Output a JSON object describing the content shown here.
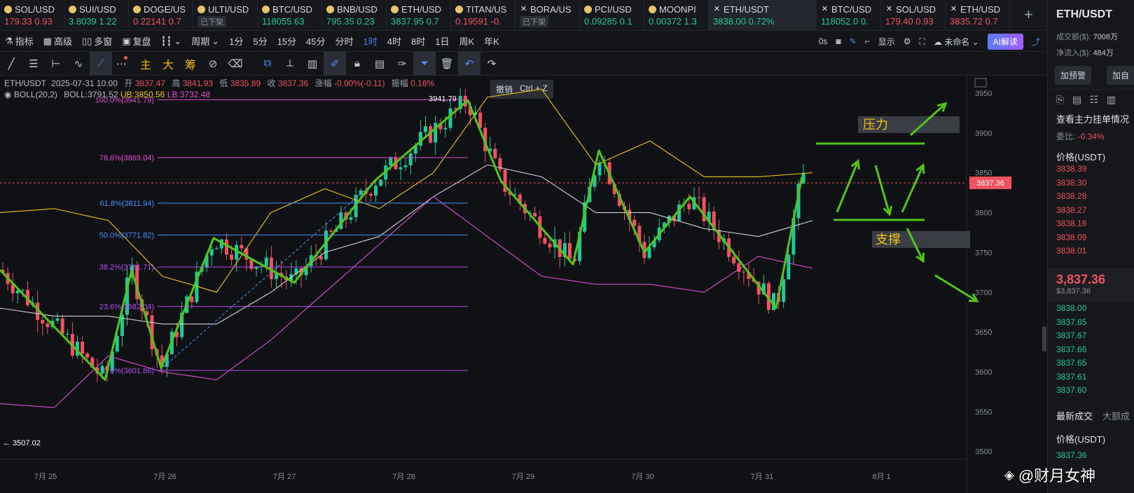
{
  "tabs": [
    {
      "symbol": "SOL/USD",
      "price": "179.33",
      "change": "0.93",
      "dir": "dn",
      "icon": "coin"
    },
    {
      "symbol": "SUI/USD",
      "price": "3.8039",
      "change": "1.22",
      "dir": "up",
      "icon": "coin"
    },
    {
      "symbol": "DOGE/US",
      "price": "0.22141",
      "change": "0.7",
      "dir": "dn",
      "icon": "coin"
    },
    {
      "symbol": "ULTI/USD",
      "price": "",
      "change": "",
      "dir": "dn",
      "icon": "coin",
      "badge": "已下架"
    },
    {
      "symbol": "BTC/USD",
      "price": "118055.63",
      "change": "",
      "dir": "up",
      "icon": "coin"
    },
    {
      "symbol": "BNB/USD",
      "price": "795.35",
      "change": "0.23",
      "dir": "up",
      "icon": "coin"
    },
    {
      "symbol": "ETH/USD",
      "price": "3837.95",
      "change": "0.7",
      "dir": "up",
      "icon": "coin"
    },
    {
      "symbol": "TITAN/US",
      "price": "0.19591",
      "change": "-0.",
      "dir": "dn",
      "icon": "coin"
    },
    {
      "symbol": "BORA/US",
      "price": "",
      "change": "",
      "dir": "dn",
      "icon": "x",
      "badge": "已下架"
    },
    {
      "symbol": "PCI/USD",
      "price": "0.09285",
      "change": "0.1",
      "dir": "up",
      "icon": "coin"
    },
    {
      "symbol": "MOONPI",
      "price": "0.00372",
      "change": "1.3",
      "dir": "up",
      "icon": "coin"
    }
  ],
  "active_tab": {
    "symbol": "ETH/USDT",
    "price": "3838.00",
    "change": "0.72%"
  },
  "right_tabs": [
    {
      "symbol": "BTC/USD",
      "price": "118052.0",
      "change": "0.",
      "dir": "up"
    },
    {
      "symbol": "SOL/USD",
      "price": "179.40",
      "change": "0.93",
      "dir": "dn"
    },
    {
      "symbol": "ETH/USD",
      "price": "3835.72",
      "change": "0.7",
      "dir": "dn"
    }
  ],
  "toolbar": {
    "indicators": "指标",
    "advanced": "高级",
    "multi_window": "多窗",
    "replay": "复盘",
    "period": "周期",
    "intervals": [
      "1分",
      "5分",
      "15分",
      "45分",
      "分时",
      "1时",
      "4时",
      "8时",
      "1日",
      "周K",
      "年K"
    ],
    "active_interval": "1时",
    "delay": "0s",
    "display": "显示",
    "unnamed": "未命名",
    "ai": "AI解读"
  },
  "drawing_tools": {
    "main": "主",
    "big": "大",
    "chip": "筹"
  },
  "info": {
    "symbol": "ETH/USDT",
    "datetime": "2025-07-31 10:00",
    "open_label": "开",
    "open": "3837.47",
    "high_label": "高",
    "high": "3841.93",
    "low_label": "低",
    "low": "3835.89",
    "close_label": "收",
    "close": "3837.36",
    "change_label": "涨幅",
    "change": "-0.00%(-0.11)",
    "amp_label": "振幅",
    "amp": "0.16%"
  },
  "boll": {
    "name": "BOLL(20,2)",
    "boll": "BOLL:3791.52",
    "ub": "UB:3850.56",
    "lb": "LB:3732.48"
  },
  "tooltip": {
    "label": "撤销",
    "shortcut": "Ctrl + Z"
  },
  "chart_data": {
    "type": "candlestick",
    "x_ticks": [
      "7月 25",
      "7月 26",
      "7月 27",
      "7月 28",
      "7月 29",
      "7月 30",
      "7月 31",
      "8月 1"
    ],
    "y_ticks": [
      3950,
      3900,
      3850,
      3800,
      3750,
      3700,
      3650,
      3600,
      3550,
      3500
    ],
    "ylim": [
      3490,
      3965
    ],
    "fib_levels": [
      {
        "label": "100.0%(3941.79)",
        "value": 3941.79,
        "color": "#e34bd6"
      },
      {
        "label": "78.6%(3869.04)",
        "value": 3869.04,
        "color": "#e34bd6"
      },
      {
        "label": "61.8%(3811.94)",
        "value": 3811.94,
        "color": "#4d8cff"
      },
      {
        "label": "50.0%(3771.82)",
        "value": 3771.82,
        "color": "#4d8cff"
      },
      {
        "label": "38.2%(3731.71)",
        "value": 3731.71,
        "color": "#b14cf2"
      },
      {
        "label": "23.6%(3682.04)",
        "value": 3682.04,
        "color": "#b14cf2"
      },
      {
        "label": "0.0%(3601.86)",
        "value": 3601.86,
        "color": "#b14cf2"
      }
    ],
    "high_marker": "3941.79",
    "low_marker": "3507.02",
    "last_price": "3837.36",
    "annotation_pressure": "压力",
    "annotation_support": "支撑",
    "zigzag_prices": [
      3728,
      3590,
      3728,
      3605,
      3768,
      3712,
      3840,
      3941,
      3840,
      3735,
      3878,
      3750,
      3820,
      3680,
      3845
    ],
    "upper_band": [
      3800,
      3805,
      3790,
      3720,
      3700,
      3800,
      3830,
      3805,
      3850,
      3945,
      3955,
      3860,
      3890,
      3845,
      3845,
      3850
    ],
    "lower_band": [
      3560,
      3555,
      3620,
      3600,
      3590,
      3640,
      3700,
      3760,
      3820,
      3770,
      3720,
      3710,
      3710,
      3700,
      3745,
      3730
    ],
    "middle_band": [
      3680,
      3670,
      3670,
      3660,
      3660,
      3700,
      3750,
      3770,
      3820,
      3860,
      3845,
      3800,
      3800,
      3780,
      3770,
      3790
    ]
  },
  "right_panel": {
    "title": "ETH/USDT",
    "turnover_label": "成交额($):",
    "turnover": "7008万",
    "inflow_label": "净流入($):",
    "inflow": "484万",
    "alert_btn": "加预警",
    "add_btn": "加自",
    "main_orders": "查看主力挂单情况",
    "ratio_label": "委比:",
    "ratio": "-0.34%",
    "price_header": "价格(USDT)",
    "asks": [
      "3838.39",
      "3838.30",
      "3838.28",
      "3838.27",
      "3838.16",
      "3838.09",
      "3838.01"
    ],
    "last_price": "3,837.36",
    "last_price_sub": "$3,837.36",
    "bids": [
      "3838.00",
      "3837.85",
      "3837.67",
      "3837.66",
      "3837.65",
      "3837.61",
      "3837.60"
    ],
    "tab_latest": "最新成交",
    "tab_big": "大额成",
    "trades_header": "价格(USDT)",
    "trade_price": "3837.36"
  },
  "watermark": "@财月女神",
  "colors": {
    "up": "#20c997",
    "down": "#f0525f",
    "accent": "#3d7ff5",
    "annotation": "#52c41a",
    "boll_ub": "#f0c419",
    "boll_lb": "#e34bd6"
  }
}
